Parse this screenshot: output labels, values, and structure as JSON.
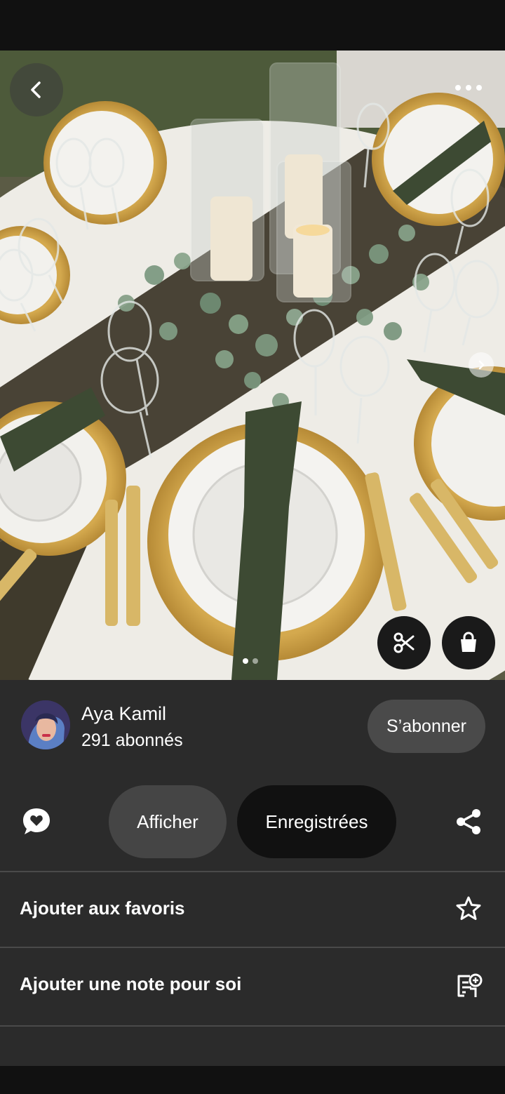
{
  "creator": {
    "name": "Aya Kamil",
    "followers": "291 abonnés",
    "follow_label": "S’abonner"
  },
  "actions": {
    "view_label": "Afficher",
    "saved_label": "Enregistrées"
  },
  "menu": {
    "items": [
      {
        "label": "Ajouter aux favoris",
        "icon": "star-icon"
      },
      {
        "label": "Ajouter une note pour soi",
        "icon": "add-note-icon"
      }
    ]
  },
  "carousel": {
    "pages": 2,
    "current": 1
  },
  "colors": {
    "sheet_bg": "#2b2b2b",
    "follow_bg": "#4a4a4a",
    "view_bg": "#454545",
    "saved_bg": "#111111"
  }
}
